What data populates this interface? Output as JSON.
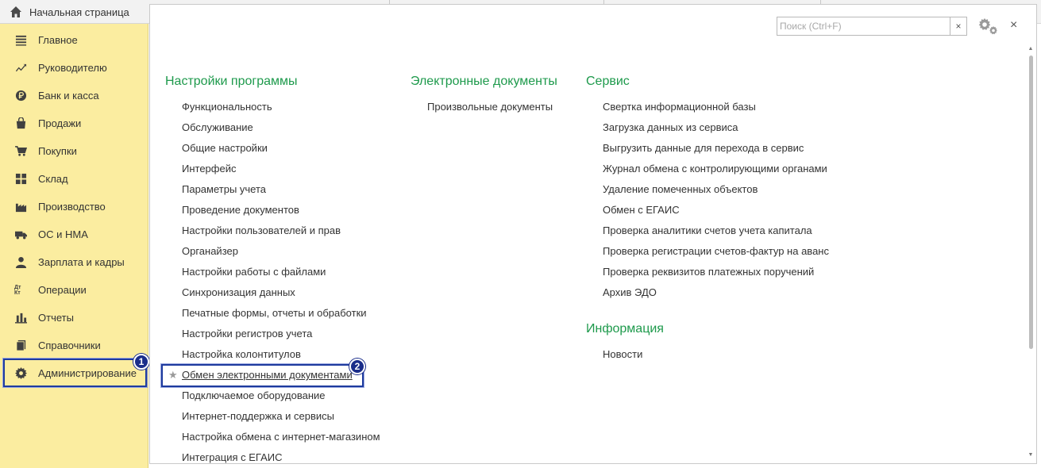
{
  "tabs": {
    "home_label": "Начальная страница"
  },
  "sidebar": {
    "items": [
      {
        "label": "Главное",
        "icon": "menu-lines-icon"
      },
      {
        "label": "Руководителю",
        "icon": "trend-chart-icon"
      },
      {
        "label": "Банк и касса",
        "icon": "ruble-coin-icon"
      },
      {
        "label": "Продажи",
        "icon": "shopping-bag-icon"
      },
      {
        "label": "Покупки",
        "icon": "shopping-cart-icon"
      },
      {
        "label": "Склад",
        "icon": "warehouse-grid-icon"
      },
      {
        "label": "Производство",
        "icon": "factory-icon"
      },
      {
        "label": "ОС и НМА",
        "icon": "truck-icon"
      },
      {
        "label": "Зарплата и кадры",
        "icon": "person-icon"
      },
      {
        "label": "Операции",
        "icon": "debit-credit-icon"
      },
      {
        "label": "Отчеты",
        "icon": "bar-chart-icon"
      },
      {
        "label": "Справочники",
        "icon": "books-icon"
      },
      {
        "label": "Администрирование",
        "icon": "gear-icon"
      }
    ],
    "debit_credit_text": "Дт Кт"
  },
  "search": {
    "placeholder": "Поиск (Ctrl+F)",
    "clear": "×"
  },
  "window": {
    "close": "×"
  },
  "annotations": {
    "badge1": "1",
    "badge2": "2"
  },
  "sections": {
    "settings": {
      "title": "Настройки программы",
      "links": [
        "Функциональность",
        "Обслуживание",
        "Общие настройки",
        "Интерфейс",
        "Параметры учета",
        "Проведение документов",
        "Настройки пользователей и прав",
        "Органайзер",
        "Настройки работы с файлами",
        "Синхронизация данных",
        "Печатные формы, отчеты и обработки",
        "Настройки регистров учета",
        "Настройка колонтитулов",
        "Обмен электронными документами",
        "Подключаемое оборудование",
        "Интернет-поддержка и сервисы",
        "Настройка обмена с интернет-магазином",
        "Интеграция с ЕГАИС"
      ]
    },
    "edocs": {
      "title": "Электронные документы",
      "links": [
        "Произвольные документы"
      ]
    },
    "service": {
      "title": "Сервис",
      "links": [
        "Свертка информационной базы",
        "Загрузка данных из сервиса",
        "Выгрузить данные для перехода в сервис",
        "Журнал обмена с контролирующими органами",
        "Удаление помеченных объектов",
        "Обмен с ЕГАИС",
        "Проверка аналитики счетов учета капитала",
        "Проверка регистрации счетов-фактур на аванс",
        "Проверка реквизитов платежных поручений",
        "Архив ЭДО"
      ]
    },
    "info": {
      "title": "Информация",
      "links": [
        "Новости"
      ]
    }
  },
  "favorite_star": "★",
  "colors": {
    "sidebar_bg": "#fbeda0",
    "section_title": "#1e9a4c",
    "highlight": "#1e3b9e"
  }
}
